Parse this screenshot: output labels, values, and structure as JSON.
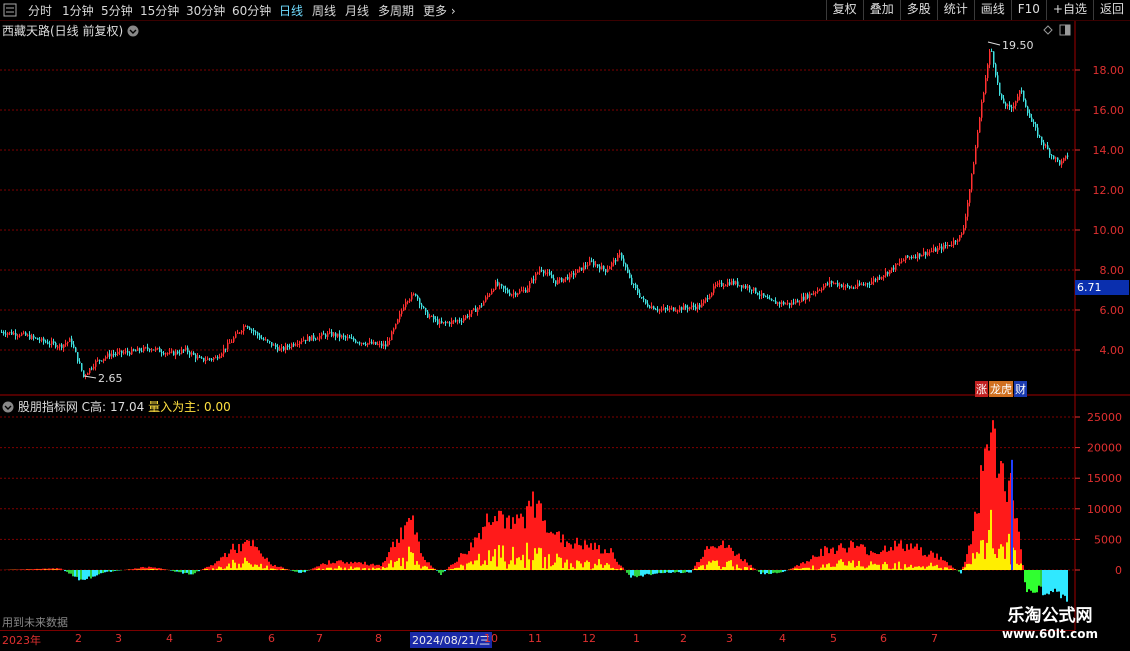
{
  "toolbar": {
    "timeframes": [
      "分时",
      "1分钟",
      "5分钟",
      "15分钟",
      "30分钟",
      "60分钟",
      "日线",
      "周线",
      "月线",
      "多周期",
      "更多"
    ],
    "active": "日线",
    "buttons": [
      "复权",
      "叠加",
      "多股",
      "统计",
      "画线",
      "F10",
      "+自选",
      "返回"
    ],
    "more_label": "更多"
  },
  "chart": {
    "title": "西藏天路(日线 前复权)",
    "price_axis": [
      "18.00",
      "16.00",
      "14.00",
      "12.00",
      "10.00",
      "8.00",
      "6.00",
      "4.00"
    ],
    "high_label": "19.50",
    "low_label": "2.65",
    "last_price": "6.71",
    "badges": [
      "涨",
      "龙虎",
      "财"
    ],
    "colors": {
      "up": "#ff3030",
      "down": "#40e0e0",
      "grid": "#800000",
      "axis": "#e03030"
    }
  },
  "indicator": {
    "name": "股朋指标网",
    "c_high_label": "C高:",
    "c_high_value": "17.04",
    "main_label": "量入为主:",
    "main_value": "0.00",
    "axis": [
      "25000",
      "20000",
      "15000",
      "10000",
      "5000",
      "0"
    ]
  },
  "time_axis": {
    "year_label": "2023年",
    "months": [
      "2",
      "3",
      "4",
      "5",
      "6",
      "7",
      "8",
      "10",
      "11",
      "12",
      "1",
      "2",
      "3",
      "4",
      "5",
      "6",
      "7"
    ],
    "selected_date": "2024/08/21/三"
  },
  "footer": {
    "future_data": "用到未来数据"
  },
  "watermark": {
    "line1": "乐淘公式网",
    "line2": "www.60lt.com"
  },
  "chart_data": {
    "type": "candlestick",
    "price_ylim": [
      2.0,
      20.0
    ],
    "indicator_ylim": [
      -5000,
      25000
    ],
    "price_path": [
      [
        0,
        4.9
      ],
      [
        20,
        4.8
      ],
      [
        45,
        4.4
      ],
      [
        60,
        4.2
      ],
      [
        70,
        4.5
      ],
      [
        83,
        2.7
      ],
      [
        95,
        3.4
      ],
      [
        110,
        3.8
      ],
      [
        130,
        3.9
      ],
      [
        150,
        4.1
      ],
      [
        170,
        3.8
      ],
      [
        185,
        4.0
      ],
      [
        200,
        3.5
      ],
      [
        215,
        3.6
      ],
      [
        230,
        4.4
      ],
      [
        245,
        5.3
      ],
      [
        260,
        4.6
      ],
      [
        280,
        4.0
      ],
      [
        300,
        4.5
      ],
      [
        330,
        4.8
      ],
      [
        360,
        4.4
      ],
      [
        385,
        4.2
      ],
      [
        395,
        5.2
      ],
      [
        405,
        6.5
      ],
      [
        415,
        6.8
      ],
      [
        425,
        5.8
      ],
      [
        440,
        5.3
      ],
      [
        460,
        5.5
      ],
      [
        480,
        6.2
      ],
      [
        495,
        7.3
      ],
      [
        510,
        6.8
      ],
      [
        525,
        7.0
      ],
      [
        540,
        8.1
      ],
      [
        555,
        7.4
      ],
      [
        570,
        7.7
      ],
      [
        590,
        8.4
      ],
      [
        605,
        8.0
      ],
      [
        620,
        8.8
      ],
      [
        630,
        7.4
      ],
      [
        645,
        6.3
      ],
      [
        660,
        6.0
      ],
      [
        680,
        6.1
      ],
      [
        700,
        6.2
      ],
      [
        715,
        7.2
      ],
      [
        730,
        7.4
      ],
      [
        750,
        7.1
      ],
      [
        770,
        6.4
      ],
      [
        790,
        6.3
      ],
      [
        810,
        6.8
      ],
      [
        830,
        7.4
      ],
      [
        850,
        7.1
      ],
      [
        870,
        7.4
      ],
      [
        890,
        8.0
      ],
      [
        905,
        8.6
      ],
      [
        920,
        8.8
      ],
      [
        935,
        9.0
      ],
      [
        950,
        9.3
      ],
      [
        962,
        9.8
      ],
      [
        972,
        13.0
      ],
      [
        980,
        16.0
      ],
      [
        990,
        19.2
      ],
      [
        1000,
        16.5
      ],
      [
        1010,
        16.0
      ],
      [
        1020,
        17.0
      ],
      [
        1030,
        15.5
      ],
      [
        1040,
        14.5
      ],
      [
        1050,
        13.8
      ],
      [
        1060,
        13.3
      ],
      [
        1068,
        13.8
      ]
    ],
    "indicator_profile": [
      [
        0,
        0
      ],
      [
        60,
        300
      ],
      [
        80,
        -2000
      ],
      [
        100,
        -500
      ],
      [
        150,
        600
      ],
      [
        190,
        -800
      ],
      [
        215,
        1200
      ],
      [
        230,
        3500
      ],
      [
        250,
        4500
      ],
      [
        270,
        1000
      ],
      [
        300,
        -600
      ],
      [
        330,
        1500
      ],
      [
        360,
        1200
      ],
      [
        380,
        800
      ],
      [
        395,
        5000
      ],
      [
        410,
        9500
      ],
      [
        420,
        2500
      ],
      [
        440,
        -800
      ],
      [
        470,
        4000
      ],
      [
        495,
        11000
      ],
      [
        510,
        7000
      ],
      [
        535,
        11500
      ],
      [
        560,
        5000
      ],
      [
        590,
        4000
      ],
      [
        610,
        3000
      ],
      [
        620,
        800
      ],
      [
        630,
        -1200
      ],
      [
        660,
        -500
      ],
      [
        690,
        -400
      ],
      [
        710,
        5000
      ],
      [
        730,
        3500
      ],
      [
        760,
        -600
      ],
      [
        780,
        -500
      ],
      [
        800,
        1000
      ],
      [
        820,
        3200
      ],
      [
        850,
        4200
      ],
      [
        875,
        3000
      ],
      [
        890,
        4200
      ],
      [
        910,
        4000
      ],
      [
        935,
        2500
      ],
      [
        950,
        700
      ],
      [
        960,
        -500
      ],
      [
        970,
        5000
      ],
      [
        980,
        15000
      ],
      [
        988,
        24000
      ],
      [
        1000,
        17000
      ],
      [
        1012,
        13000
      ],
      [
        1025,
        -3000
      ],
      [
        1040,
        -3500
      ],
      [
        1055,
        -3200
      ],
      [
        1068,
        -5000
      ]
    ],
    "series": [
      {
        "name": "C高",
        "values": [
          17.04
        ]
      },
      {
        "name": "量入为主",
        "values": [
          0.0
        ]
      }
    ]
  }
}
